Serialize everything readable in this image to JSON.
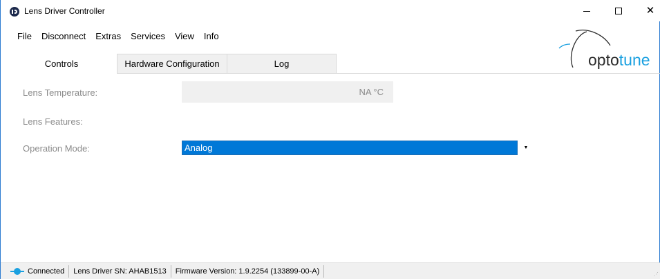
{
  "window": {
    "title": "Lens Driver Controller",
    "icon": "lens-driver-app-icon"
  },
  "menu": [
    "File",
    "Disconnect",
    "Extras",
    "Services",
    "View",
    "Info"
  ],
  "logo": {
    "prefix": "opto",
    "suffix": "tune",
    "accent_color": "#1aa0e0"
  },
  "tabs": [
    {
      "label": "Controls",
      "active": true
    },
    {
      "label": "Hardware Configuration",
      "active": false
    },
    {
      "label": "Log",
      "active": false
    }
  ],
  "controls": {
    "temperature_label": "Lens Temperature:",
    "temperature_value": "NA  °C",
    "features_label": "Lens Features:",
    "mode_label": "Operation Mode:",
    "mode_value": "Analog"
  },
  "status": {
    "connection": "Connected",
    "serial": "Lens Driver SN: AHAB1513",
    "firmware": "Firmware Version: 1.9.2254 (133899-00-A)"
  },
  "colors": {
    "accent": "#0078d7",
    "window_border": "#2b7bd1",
    "connected": "#1aa0e0"
  }
}
